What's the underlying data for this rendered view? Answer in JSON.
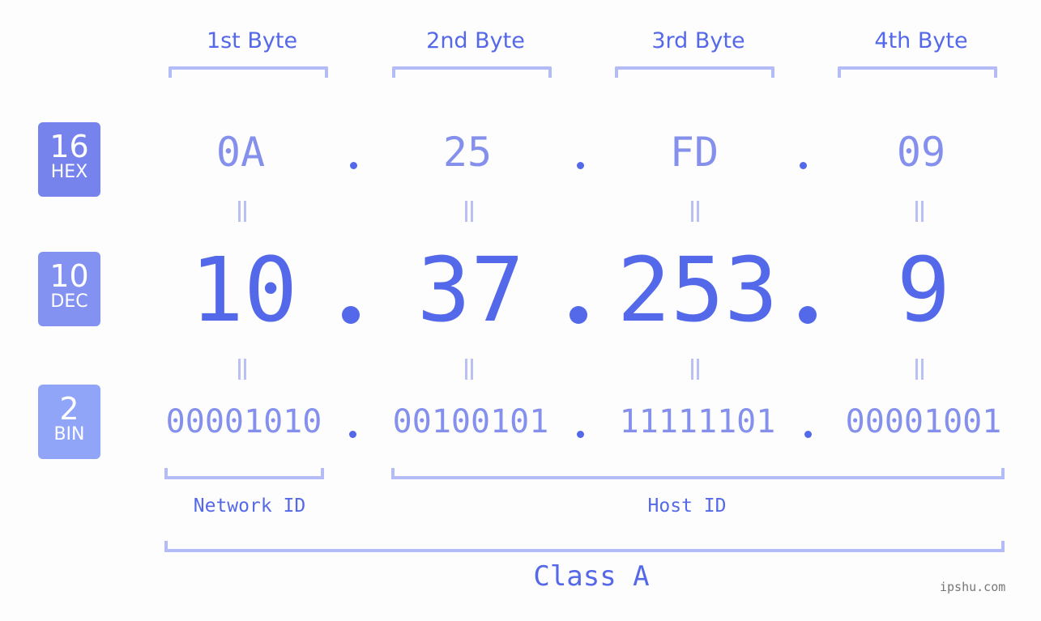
{
  "byte_headers": [
    "1st Byte",
    "2nd Byte",
    "3rd Byte",
    "4th Byte"
  ],
  "badges": {
    "hex": {
      "base": "16",
      "label": "HEX",
      "color": "#7683ec"
    },
    "dec": {
      "base": "10",
      "label": "DEC",
      "color": "#8392f1"
    },
    "bin": {
      "base": "2",
      "label": "BIN",
      "color": "#90a5f8"
    }
  },
  "ip": {
    "hex": [
      "0A",
      "25",
      "FD",
      "09"
    ],
    "dec": [
      "10",
      "37",
      "253",
      "9"
    ],
    "bin": [
      "00001010",
      "00100101",
      "11111101",
      "00001001"
    ]
  },
  "parts": {
    "network_label": "Network ID",
    "host_label": "Host ID",
    "class_label": "Class A"
  },
  "watermark": "ipshu.com",
  "colors": {
    "accent": "#5369ea",
    "light_accent": "#8590ec",
    "bracket": "#b3bcf6"
  }
}
